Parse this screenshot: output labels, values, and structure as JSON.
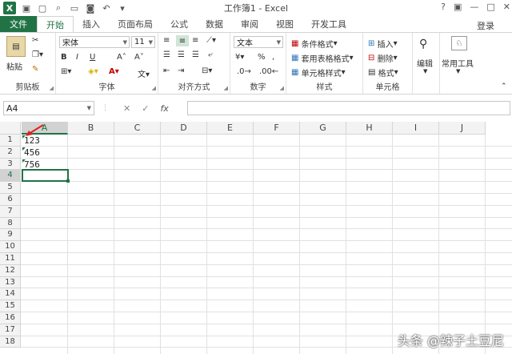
{
  "window": {
    "title": "工作簿1 - Excel",
    "controls": [
      "?",
      "▣",
      "—",
      "□",
      "✕"
    ]
  },
  "tabs": [
    {
      "label": "文件"
    },
    {
      "label": "开始"
    },
    {
      "label": "插入"
    },
    {
      "label": "页面布局"
    },
    {
      "label": "公式"
    },
    {
      "label": "数据"
    },
    {
      "label": "审阅"
    },
    {
      "label": "视图"
    },
    {
      "label": "开发工具"
    }
  ],
  "login": "登录",
  "ribbon": {
    "clipboard": {
      "label": "剪贴板",
      "paste": "粘贴"
    },
    "font": {
      "label": "字体",
      "name": "宋体",
      "size": "11",
      "bold": "B",
      "italic": "I",
      "underline": "U"
    },
    "align": {
      "label": "对齐方式"
    },
    "number": {
      "label": "数字",
      "format": "文本",
      "percent": "%",
      "comma": ","
    },
    "styles": {
      "label": "样式",
      "cond": "条件格式",
      "table": "套用表格格式",
      "cell": "单元格样式"
    },
    "cells": {
      "label": "单元格",
      "insert": "插入",
      "delete": "删除",
      "format": "格式"
    },
    "editing": {
      "label": "编辑"
    },
    "tools": {
      "label": "常用工具"
    }
  },
  "formula": {
    "namebox": "A4",
    "cancel": "✕",
    "enter": "✓",
    "fx": "fx",
    "value": ""
  },
  "columns": [
    "A",
    "B",
    "C",
    "D",
    "E",
    "F",
    "G",
    "H",
    "I",
    "J"
  ],
  "rows": [
    "1",
    "2",
    "3",
    "4",
    "5",
    "6",
    "7",
    "8",
    "9",
    "10",
    "11",
    "12",
    "13",
    "14",
    "15",
    "16",
    "17",
    "18"
  ],
  "cells": [
    {
      "row": 1,
      "value": "123"
    },
    {
      "row": 2,
      "value": "456"
    },
    {
      "row": 3,
      "value": "756"
    }
  ],
  "selected_cell": "A4",
  "watermark": "头条 @辣子土豆尼",
  "colors": {
    "accent": "#217346"
  }
}
